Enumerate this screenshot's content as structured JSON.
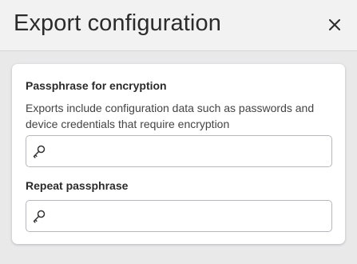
{
  "dialog": {
    "title": "Export configuration",
    "close_icon": "close-icon"
  },
  "form": {
    "passphrase": {
      "label": "Passphrase for encryption",
      "help": "Exports include configuration data such as passwords and device credentials that require encryption",
      "value": "",
      "placeholder": "",
      "icon": "key-icon"
    },
    "repeat": {
      "label": "Repeat passphrase",
      "value": "",
      "placeholder": "",
      "icon": "key-icon"
    }
  },
  "colors": {
    "header_bg": "#f2f2f3",
    "page_bg": "#e9e9ea",
    "card_bg": "#ffffff",
    "field_border": "#b8b8bc",
    "text": "#2b2b2b"
  }
}
